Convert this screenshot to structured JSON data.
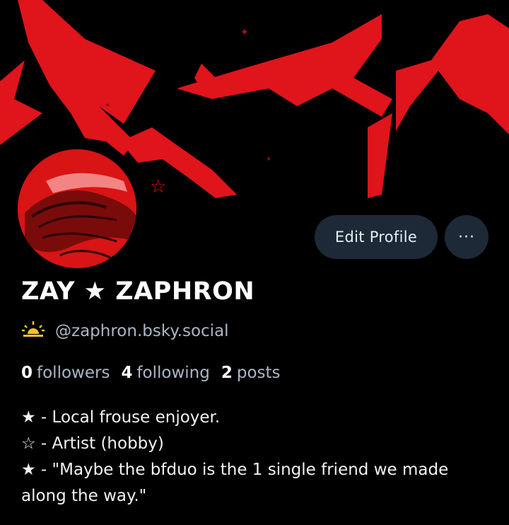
{
  "colors": {
    "accent": "#e0141b",
    "button_bg": "#1e2937",
    "muted_text": "#aab6c4"
  },
  "profile": {
    "display_name": "ZAY ★ ZAPHRON",
    "handle": "@zaphron.bsky.social",
    "handle_icon": "sunrise-icon"
  },
  "actions": {
    "edit_label": "Edit Profile",
    "more_label": "···"
  },
  "stats": {
    "followers_count": "0",
    "followers_label": "followers",
    "following_count": "4",
    "following_label": "following",
    "posts_count": "2",
    "posts_label": "posts"
  },
  "bio": {
    "line1": "★ - Local frouse enjoyer.",
    "line2": "☆ - Artist (hobby)",
    "line3": "★ - \"Maybe the bfduo is the 1 single friend we made along the way.\""
  }
}
